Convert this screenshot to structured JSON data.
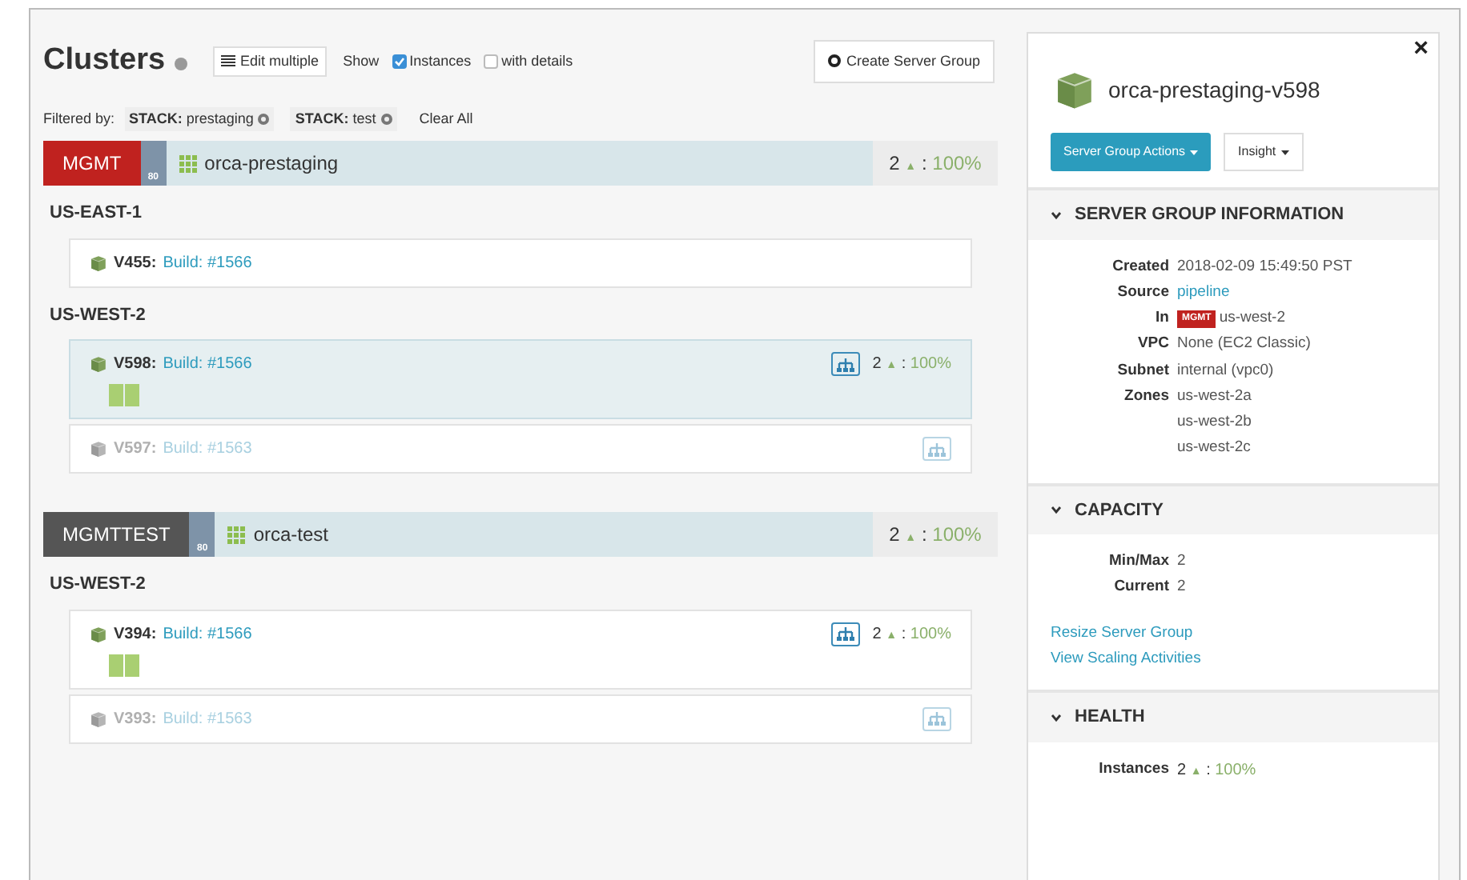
{
  "header": {
    "title": "Clusters",
    "edit_button": "Edit multiple",
    "show_label": "Show",
    "options": [
      {
        "label": "Instances",
        "checked": true
      },
      {
        "label": "with details",
        "checked": false
      }
    ],
    "create_button": "Create Server Group"
  },
  "filters": {
    "label": "Filtered by:",
    "tags": [
      "**STACK:** prestaging",
      "**STACK:** test"
    ],
    "clear": "Clear All"
  },
  "clusters": [
    {
      "account": "MGMT",
      "color": "#c0221f",
      "port": "80",
      "name": "orca-prestaging",
      "health": {
        "count": "2",
        "arrow": "▲",
        "sep": ":",
        "percent": "100%"
      },
      "regions": [
        {
          "name": "US-EAST-1",
          "server_groups": [
            {
              "version": "V455:",
              "build": "Build: #1566",
              "selected": false,
              "disabled": false,
              "load_balancer": false
            }
          ]
        },
        {
          "name": "US-WEST-2",
          "server_groups": [
            {
              "version": "V598:",
              "build": "Build: #1566",
              "selected": true,
              "disabled": false,
              "load_balancer": true,
              "instances": [
                {
                  "healthy": true
                },
                {
                  "healthy": true
                }
              ],
              "health": {
                "count": "2",
                "arrow": "▲",
                "sep": ":",
                "percent": "100%"
              }
            },
            {
              "version": "V597:",
              "build": "Build: #1563",
              "selected": false,
              "disabled": true,
              "load_balancer": true
            }
          ]
        }
      ]
    },
    {
      "account": "MGMTTEST",
      "color": "#555555",
      "port": "80",
      "name": "orca-test",
      "health": {
        "count": "2",
        "arrow": "▲",
        "sep": ":",
        "percent": "100%"
      },
      "regions": [
        {
          "name": "US-WEST-2",
          "server_groups": [
            {
              "version": "V394:",
              "build": "Build: #1566",
              "selected": false,
              "disabled": false,
              "load_balancer": true,
              "instances": [
                {
                  "healthy": true
                },
                {
                  "healthy": true
                }
              ],
              "health": {
                "count": "2",
                "arrow": "▲",
                "sep": ":",
                "percent": "100%"
              }
            },
            {
              "version": "V393:",
              "build": "Build: #1563",
              "selected": false,
              "disabled": true,
              "load_balancer": true
            }
          ]
        }
      ]
    }
  ],
  "details": {
    "close": "×",
    "title": "orca-prestaging-v598",
    "actions_button": "Server Group Actions",
    "insight_button": "Insight",
    "sections": [
      {
        "title": "SERVER GROUP INFORMATION",
        "expanded": true,
        "rows": [
          {
            "kind": "text",
            "label": "Created",
            "values": [
              "2018-02-09 15:49:50 PST"
            ]
          },
          {
            "kind": "link",
            "label": "Source",
            "values": [
              "pipeline"
            ]
          },
          {
            "kind": "account",
            "label": "In",
            "badge": "MGMT",
            "values": [
              "us-west-2"
            ]
          },
          {
            "kind": "text",
            "label": "VPC",
            "values": [
              "None (EC2 Classic)"
            ]
          },
          {
            "kind": "text",
            "label": "Subnet",
            "values": [
              "internal (vpc0)"
            ]
          },
          {
            "kind": "text",
            "label": "Zones",
            "values": [
              "us-west-2a",
              "us-west-2b",
              "us-west-2c"
            ]
          }
        ]
      },
      {
        "title": "CAPACITY",
        "expanded": true,
        "rows": [
          {
            "kind": "text",
            "label": "Min/Max",
            "values": [
              "2"
            ]
          },
          {
            "kind": "text",
            "label": "Current",
            "values": [
              "2"
            ]
          }
        ],
        "links": [
          "Resize Server Group",
          "View Scaling Activities"
        ]
      },
      {
        "title": "HEALTH",
        "expanded": true,
        "rows": [
          {
            "kind": "health",
            "label": "Instances",
            "health": {
              "count": "2",
              "arrow": "▲",
              "sep": ":",
              "percent": "100%"
            }
          }
        ]
      }
    ]
  }
}
